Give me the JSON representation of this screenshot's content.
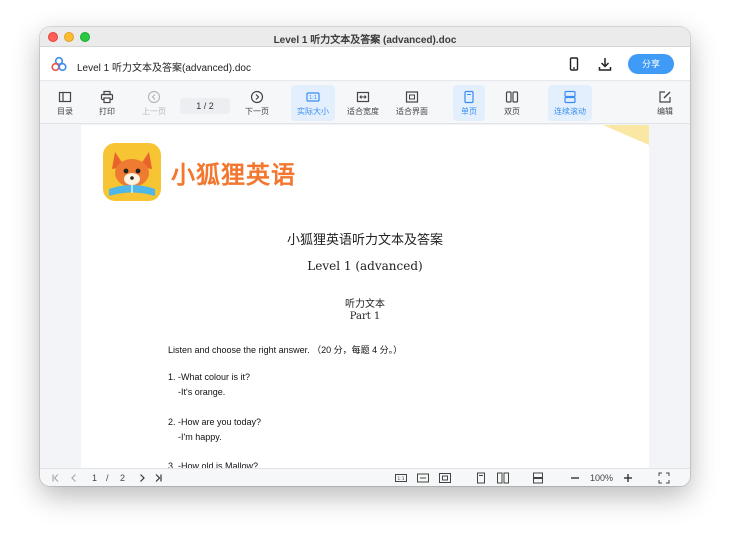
{
  "window": {
    "title": "Level 1 听力文本及答案 (advanced).doc"
  },
  "header": {
    "doc_name": "Level 1 听力文本及答案(advanced).doc",
    "share_label": "分享"
  },
  "toolbar": {
    "toc": "目录",
    "print": "打印",
    "prev_page": "上一页",
    "page_indicator": "1  /  2",
    "next_page": "下一页",
    "actual_size": "实际大小",
    "fit_width": "适合宽度",
    "fit_page": "适合界面",
    "single_page": "单页",
    "double_page": "双页",
    "continuous": "连续滚动",
    "edit": "编辑",
    "active_color": "#3a8ef0"
  },
  "document": {
    "brand": "小狐狸英语",
    "title": "小狐狸英语听力文本及答案",
    "subtitle": "Level 1 (advanced)",
    "section_title": "听力文本",
    "section_part": "Part 1",
    "instruction": "Listen and choose the right answer.  （20 分，每题 4 分。）",
    "q1": "1. -What colour is it?",
    "a1": "-It's orange.",
    "q2": "2. -How are you today?",
    "a2": "-I'm happy.",
    "q3": "3. -How old is Mallow?"
  },
  "statusbar": {
    "page_current": "1",
    "page_sep": "/",
    "page_total": "2",
    "zoom": "100%"
  }
}
